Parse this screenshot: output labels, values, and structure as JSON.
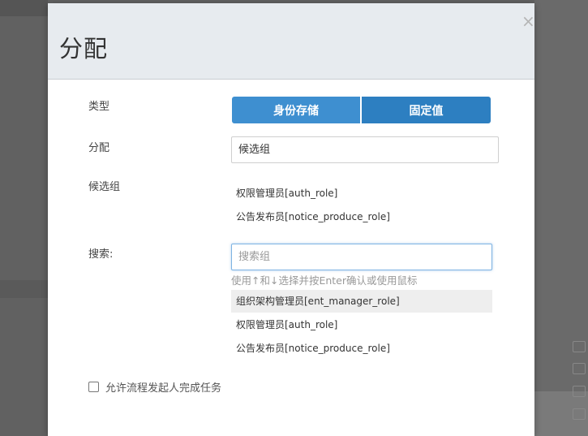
{
  "dialog": {
    "title": "分配",
    "close_glyph": "×"
  },
  "form": {
    "type_label": "类型",
    "type_options": [
      "身份存储",
      "固定值"
    ],
    "assign_label": "分配",
    "assign_value": "候选组",
    "candidate_label": "候选组",
    "candidates": [
      "权限管理员[auth_role]",
      "公告发布员[notice_produce_role]"
    ],
    "search_label": "搜索:",
    "search_placeholder": "搜索组",
    "search_hint": "使用↑和↓选择并按Enter确认或使用鼠标",
    "search_results": [
      "组织架构管理员[ent_manager_role]",
      "权限管理员[auth_role]",
      "公告发布员[notice_produce_role]"
    ],
    "checkbox_label": "允许流程发起人完成任务"
  },
  "colors": {
    "primary": "#3e8fd0",
    "primary_dark": "#2d7fc1",
    "header_bg": "#e7ebef"
  }
}
